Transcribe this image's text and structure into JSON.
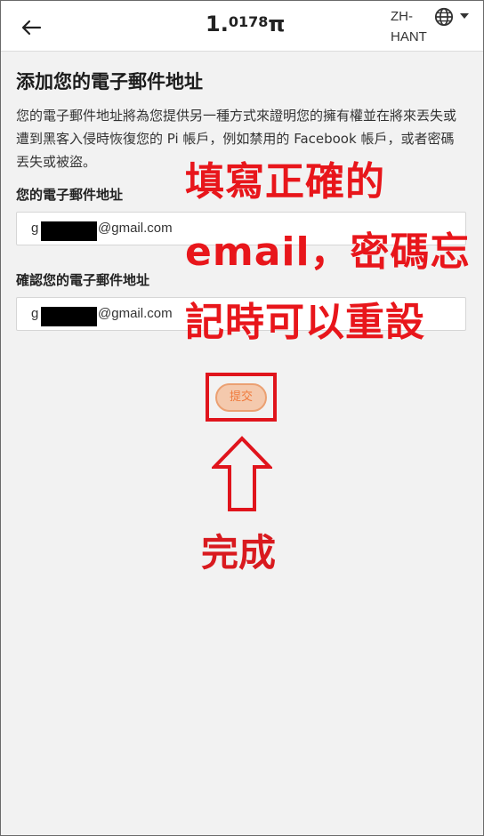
{
  "header": {
    "back_icon": "arrow-left-icon",
    "balance_main": "1.",
    "balance_frac": "0178",
    "currency": "π",
    "lang_code": "ZH-HANT",
    "globe_icon": "globe-icon"
  },
  "page": {
    "title": "添加您的電子郵件地址",
    "description": "您的電子郵件地址將為您提供另一種方式來證明您的擁有權並在將來丟失或遭到黑客入侵時恢復您的 Pi 帳戶，例如禁用的 Facebook 帳戶，或者密碼丟失或被盜。"
  },
  "form": {
    "email_label": "您的電子郵件地址",
    "email_prefix": "g",
    "email_suffix": "@gmail.com",
    "confirm_label": "確認您的電子郵件地址",
    "confirm_prefix": "g",
    "confirm_suffix": "@gmail.com",
    "submit_label": "提交"
  },
  "annotations": {
    "line1": "填寫正確的",
    "line2": "email，密碼忘",
    "line3": "記時可以重設",
    "done": "完成"
  },
  "colors": {
    "annotation_red": "#e8161b",
    "button_fill": "#f4c9ad",
    "button_text": "#f07a3c"
  }
}
